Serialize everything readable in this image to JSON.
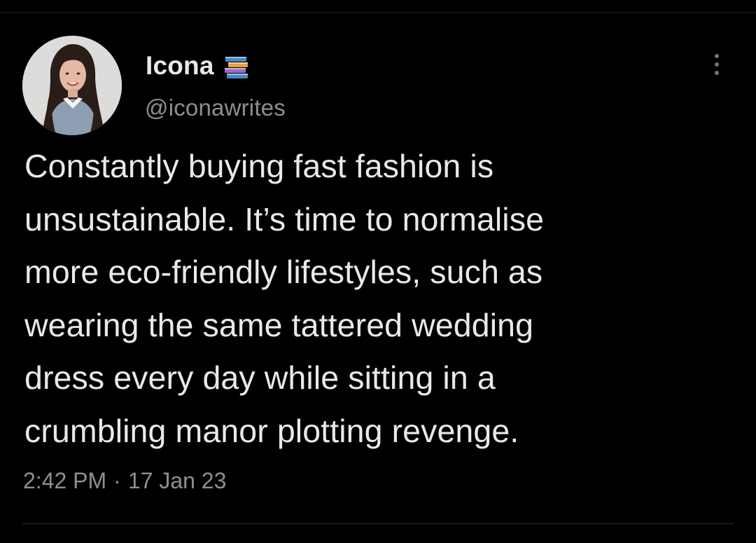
{
  "tweet": {
    "display_name": "Icona",
    "name_emoji_icon": "books-icon",
    "handle": "@iconawrites",
    "text": "Constantly buying fast fashion is\nunsustainable. It’s time to normalise\nmore eco-friendly lifestyles, such as\nwearing the same tattered wedding\ndress every day while sitting in a\ncrumbling manor plotting revenge.",
    "time": "2:42 PM",
    "separator": "·",
    "date": "17 Jan 23",
    "more_icon": "more-options-icon"
  },
  "colors": {
    "background": "#000000",
    "primary_text": "#e7e9ea",
    "secondary_text": "#8b9096",
    "divider": "#2a2d30"
  }
}
